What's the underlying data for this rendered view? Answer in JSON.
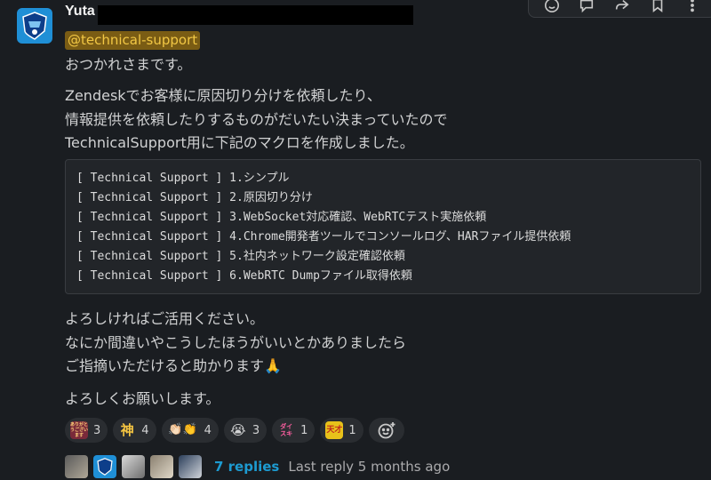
{
  "message": {
    "author": "Yuta",
    "mention": "@technical-support",
    "greeting": "おつかれさまです。",
    "intro_lines": [
      "Zendeskでお客様に原因切り分けを依頼したり、",
      "情報提供を依頼したりするものがだいたい決まっていたので",
      "TechnicalSupport用に下記のマクロを作成しました。"
    ],
    "code_lines": [
      "[ Technical Support ] 1.シンプル",
      "[ Technical Support ] 2.原因切り分け",
      "[ Technical Support ] 3.WebSocket対応確認、WebRTCテスト実施依頼",
      "[ Technical Support ] 4.Chrome開発者ツールでコンソールログ、HARファイル提供依頼",
      "[ Technical Support ] 5.社内ネットワーク設定確認依頼",
      "[ Technical Support ] 6.WebRTC Dumpファイル取得依頼"
    ],
    "outro_lines": [
      "よろしければご活用ください。",
      "なにか間違いやこうしたほうがいいとかありましたら",
      "ご指摘いただけると助かります🙏"
    ],
    "closing": "よろしくお願いします。"
  },
  "reactions": [
    {
      "emoji": "arigatou-gozaimasu-icon",
      "text": "ありがとうございます",
      "count": "3",
      "bg": "#7a2a3a"
    },
    {
      "emoji": "kami-icon",
      "text": "神",
      "count": "4",
      "bg": "#2a2d31"
    },
    {
      "emoji": "clap-icon",
      "text": "👏🏻👏",
      "count": "4",
      "bg": "#2a2d31"
    },
    {
      "emoji": "crying-face-icon",
      "text": "😭",
      "count": "3",
      "bg": "#2a2d31"
    },
    {
      "emoji": "daisuki-icon",
      "text": "ダイスキ",
      "count": "1",
      "bg": "#2a2d31"
    },
    {
      "emoji": "tensai-icon",
      "text": "天才",
      "count": "1",
      "bg": "#e8c21a"
    }
  ],
  "thread": {
    "replies": "7 replies",
    "last_reply": "Last reply 5 months ago"
  },
  "colors": {
    "link": "#1d9bd1",
    "mention_bg": "#7a5c14",
    "mention_fg": "#f2c744"
  }
}
